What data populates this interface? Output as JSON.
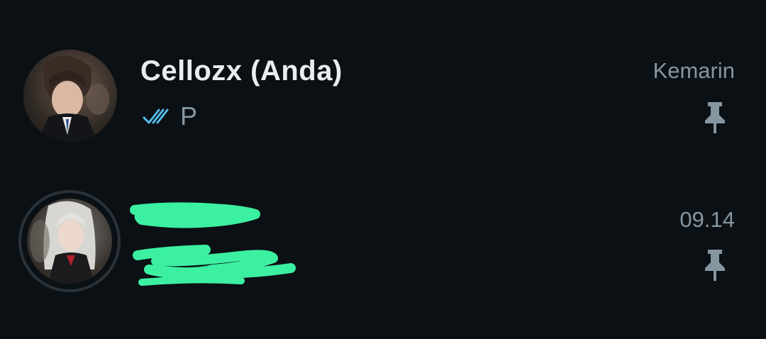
{
  "chats": [
    {
      "name": "Cellozx (Anda)",
      "preview": "P",
      "time": "Kemarin",
      "read_status_icon": "double-check-icon",
      "pinned_icon": "pin-icon"
    },
    {
      "name": "",
      "preview": "",
      "time": "09.14",
      "pinned_icon": "pin-icon"
    }
  ],
  "colors": {
    "background": "#0b1014",
    "name_text": "#e9edef",
    "secondary_text": "#8696a0",
    "read_ticks": "#53bdeb",
    "redaction": "#3cf0a2"
  }
}
